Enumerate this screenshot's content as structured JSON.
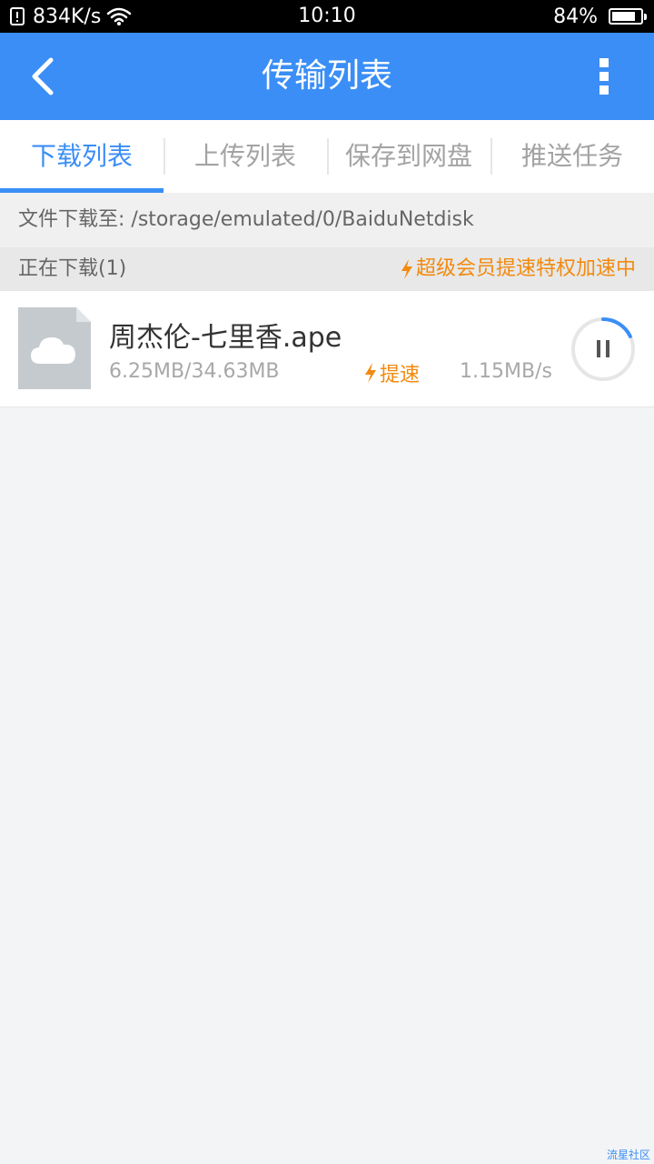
{
  "status_bar": {
    "network_speed": "834K/s",
    "time": "10:10",
    "battery": "84%",
    "battery_level": 0.84
  },
  "header": {
    "title": "传输列表"
  },
  "tabs": [
    {
      "label": "下载列表",
      "active": true
    },
    {
      "label": "上传列表",
      "active": false
    },
    {
      "label": "保存到网盘",
      "active": false
    },
    {
      "label": "推送任务",
      "active": false
    }
  ],
  "path": {
    "label": "文件下载至: /storage/emulated/0/BaiduNetdisk"
  },
  "section": {
    "title": "正在下载(1)",
    "promo": "超级会员提速特权加速中"
  },
  "download_item": {
    "filename": "周杰伦-七里香.ape",
    "size": "6.25MB/34.63MB",
    "boost_label": "提速",
    "speed": "1.15MB/s",
    "progress": 0.18
  },
  "watermark": "流星社区",
  "colors": {
    "accent": "#3a8ef6",
    "promo": "#f28a0f"
  },
  "icons": {
    "back": "chevron-left-icon",
    "more": "more-vertical-icon",
    "lightning": "lightning-icon",
    "file": "cloud-file-icon",
    "pause": "pause-icon"
  }
}
